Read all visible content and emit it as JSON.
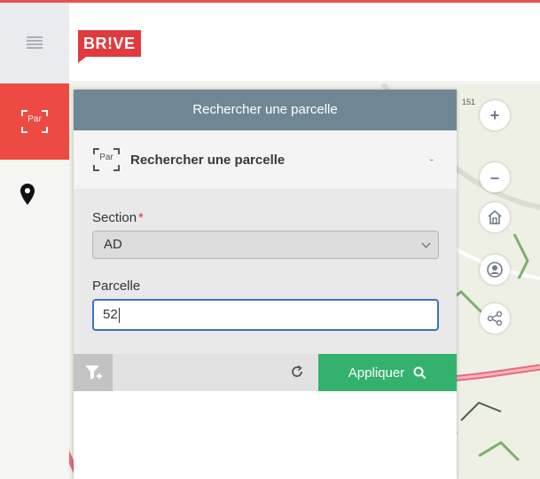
{
  "header": {
    "brand": "BR!VE"
  },
  "sidebar": {
    "active_tool_icon_text": "Par"
  },
  "panel": {
    "title": "Rechercher une parcelle",
    "subtitle": "Rechercher une parcelle",
    "icon_text": "Par",
    "collapse_symbol": "-",
    "section_label": "Section",
    "required_mark": "*",
    "section_value": "AD",
    "parcelle_label": "Parcelle",
    "parcelle_value": "52",
    "apply_label": "Appliquer"
  },
  "map": {
    "road_badge": "151"
  },
  "icons": {
    "menu": "hamburger-icon",
    "pin": "map-pin-icon",
    "filter": "filter-icon",
    "refresh": "refresh-icon",
    "search": "search-icon",
    "zoom_in": "plus-icon",
    "zoom_out": "minus-icon",
    "home": "home-icon",
    "locate": "user-location-icon",
    "share": "share-icon"
  },
  "colors": {
    "brand_red": "#e03a3e",
    "panel_header": "#6f8795",
    "apply_green": "#34b26d",
    "active_rail": "#ec4a42",
    "focus_blue": "#3a70c9"
  }
}
